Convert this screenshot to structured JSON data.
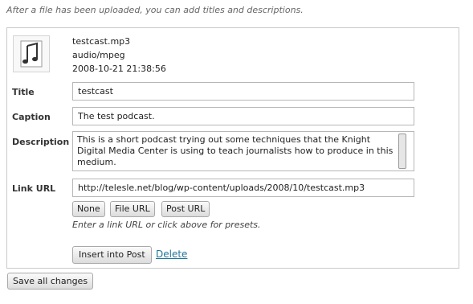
{
  "intro_text": "After a file has been uploaded, you can add titles and descriptions.",
  "file": {
    "icon": "audio-file-icon",
    "name": "testcast.mp3",
    "mime": "audio/mpeg",
    "date": "2008-10-21 21:38:56"
  },
  "fields": {
    "title": {
      "label": "Title",
      "value": "testcast"
    },
    "caption": {
      "label": "Caption",
      "value": "The test podcast."
    },
    "description": {
      "label": "Description",
      "value": "This is a short podcast trying out some techniques that the Knight Digital Media Center is using to teach journalists how to produce in this medium."
    },
    "link_url": {
      "label": "Link URL",
      "value": "http://telesle.net/blog/wp-content/uploads/2008/10/testcast.mp3"
    }
  },
  "link_buttons": {
    "none": "None",
    "file_url": "File URL",
    "post_url": "Post URL"
  },
  "link_hint": "Enter a link URL or click above for presets.",
  "actions": {
    "insert": "Insert into Post",
    "delete": "Delete"
  },
  "save_all": "Save all changes",
  "colors": {
    "link": "#21759b",
    "border": "#c9c9c9"
  }
}
